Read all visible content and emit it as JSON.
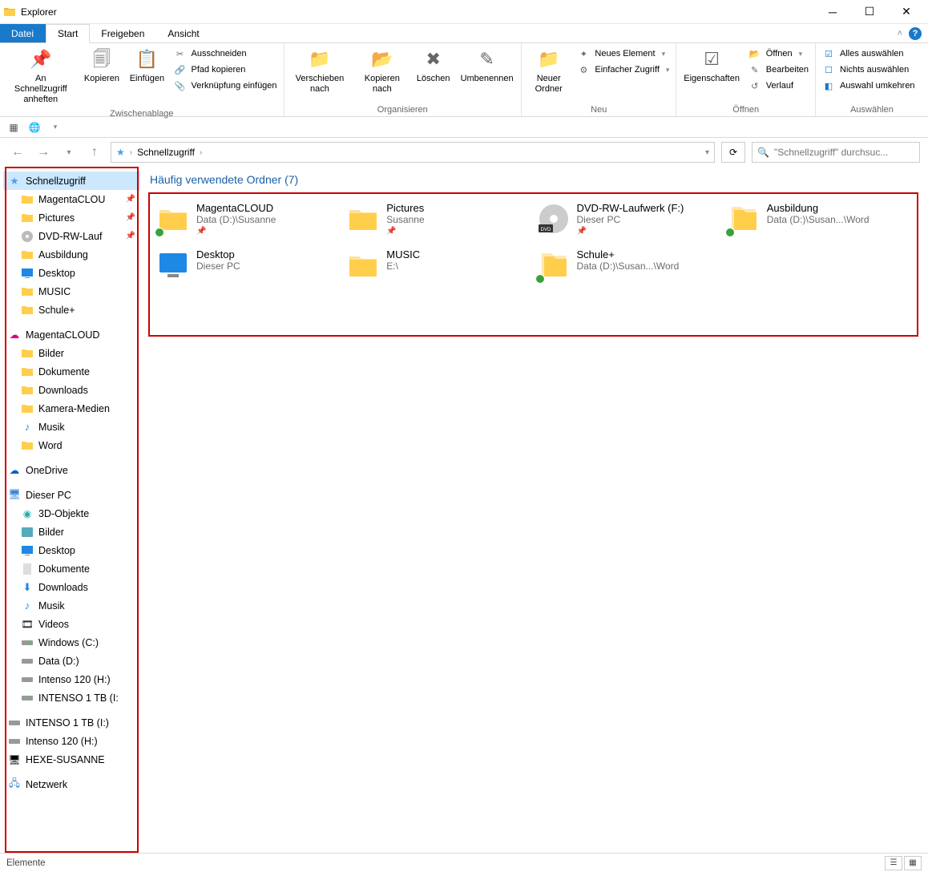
{
  "window": {
    "title": "Explorer"
  },
  "tabs": {
    "file": "Datei",
    "start": "Start",
    "share": "Freigeben",
    "view": "Ansicht"
  },
  "ribbon": {
    "clipboard": {
      "pin": "An Schnellzugriff anheften",
      "copy": "Kopieren",
      "paste": "Einfügen",
      "cut": "Ausschneiden",
      "copy_path": "Pfad kopieren",
      "paste_link": "Verknüpfung einfügen",
      "caption": "Zwischenablage"
    },
    "organize": {
      "move_to": "Verschieben nach",
      "copy_to": "Kopieren nach",
      "delete": "Löschen",
      "rename": "Umbenennen",
      "caption": "Organisieren"
    },
    "new": {
      "new_folder": "Neuer Ordner",
      "new_item": "Neues Element",
      "easy_access": "Einfacher Zugriff",
      "caption": "Neu"
    },
    "open": {
      "properties": "Eigenschaften",
      "open": "Öffnen",
      "edit": "Bearbeiten",
      "history": "Verlauf",
      "caption": "Öffnen"
    },
    "select": {
      "select_all": "Alles auswählen",
      "select_none": "Nichts auswählen",
      "invert": "Auswahl umkehren",
      "caption": "Auswählen"
    }
  },
  "breadcrumb": {
    "root": "Schnellzugriff"
  },
  "search": {
    "placeholder": "\"Schnellzugriff\" durchsuc..."
  },
  "section_header": "Häufig verwendete Ordner (7)",
  "folders": [
    {
      "name": "MagentaCLOUD",
      "path": "Data (D:)\\Susanne",
      "pinned": true,
      "sync": true,
      "icon": "folder"
    },
    {
      "name": "Pictures",
      "path": "Susanne",
      "pinned": true,
      "sync": false,
      "icon": "folder"
    },
    {
      "name": "DVD-RW-Laufwerk (F:)",
      "path": "Dieser PC",
      "pinned": true,
      "sync": false,
      "icon": "dvd"
    },
    {
      "name": "Ausbildung",
      "path": "Data (D:)\\Susan...\\Word",
      "pinned": false,
      "sync": true,
      "icon": "folder-stack"
    },
    {
      "name": "Desktop",
      "path": "Dieser PC",
      "pinned": false,
      "sync": false,
      "icon": "desktop"
    },
    {
      "name": "MUSIC",
      "path": "E:\\",
      "pinned": false,
      "sync": false,
      "icon": "folder"
    },
    {
      "name": "Schule+",
      "path": "Data (D:)\\Susan...\\Word",
      "pinned": false,
      "sync": true,
      "icon": "folder-stack"
    }
  ],
  "tree": {
    "quick": {
      "label": "Schnellzugriff",
      "items": [
        {
          "label": "MagentaCLOU",
          "icon": "folder",
          "pinned": true
        },
        {
          "label": "Pictures",
          "icon": "folder",
          "pinned": true
        },
        {
          "label": "DVD-RW-Lauf",
          "icon": "dvd",
          "pinned": true
        },
        {
          "label": "Ausbildung",
          "icon": "folder",
          "pinned": false
        },
        {
          "label": "Desktop",
          "icon": "desktop",
          "pinned": false
        },
        {
          "label": "MUSIC",
          "icon": "folder",
          "pinned": false
        },
        {
          "label": "Schule+",
          "icon": "folder",
          "pinned": false
        }
      ]
    },
    "magenta": {
      "label": "MagentaCLOUD",
      "items": [
        {
          "label": "Bilder",
          "icon": "folder"
        },
        {
          "label": "Dokumente",
          "icon": "folder"
        },
        {
          "label": "Downloads",
          "icon": "folder"
        },
        {
          "label": "Kamera-Medien",
          "icon": "folder"
        },
        {
          "label": "Musik",
          "icon": "music"
        },
        {
          "label": "Word",
          "icon": "folder"
        }
      ]
    },
    "onedrive": {
      "label": "OneDrive"
    },
    "thispc": {
      "label": "Dieser PC",
      "items": [
        {
          "label": "3D-Objekte",
          "icon": "3d"
        },
        {
          "label": "Bilder",
          "icon": "pictures"
        },
        {
          "label": "Desktop",
          "icon": "desktop"
        },
        {
          "label": "Dokumente",
          "icon": "docs"
        },
        {
          "label": "Downloads",
          "icon": "downloads"
        },
        {
          "label": "Musik",
          "icon": "music"
        },
        {
          "label": "Videos",
          "icon": "videos"
        },
        {
          "label": "Windows (C:)",
          "icon": "drive"
        },
        {
          "label": "Data (D:)",
          "icon": "drive"
        },
        {
          "label": "Intenso 120 (H:)",
          "icon": "drive"
        },
        {
          "label": "INTENSO 1 TB (I:",
          "icon": "drive"
        }
      ]
    },
    "extra_drives": [
      {
        "label": "INTENSO 1 TB (I:)",
        "icon": "drive"
      },
      {
        "label": "Intenso 120 (H:)",
        "icon": "drive"
      },
      {
        "label": "HEXE-SUSANNE",
        "icon": "pc"
      }
    ],
    "network": {
      "label": "Netzwerk"
    }
  },
  "status": {
    "items": "Elemente"
  }
}
